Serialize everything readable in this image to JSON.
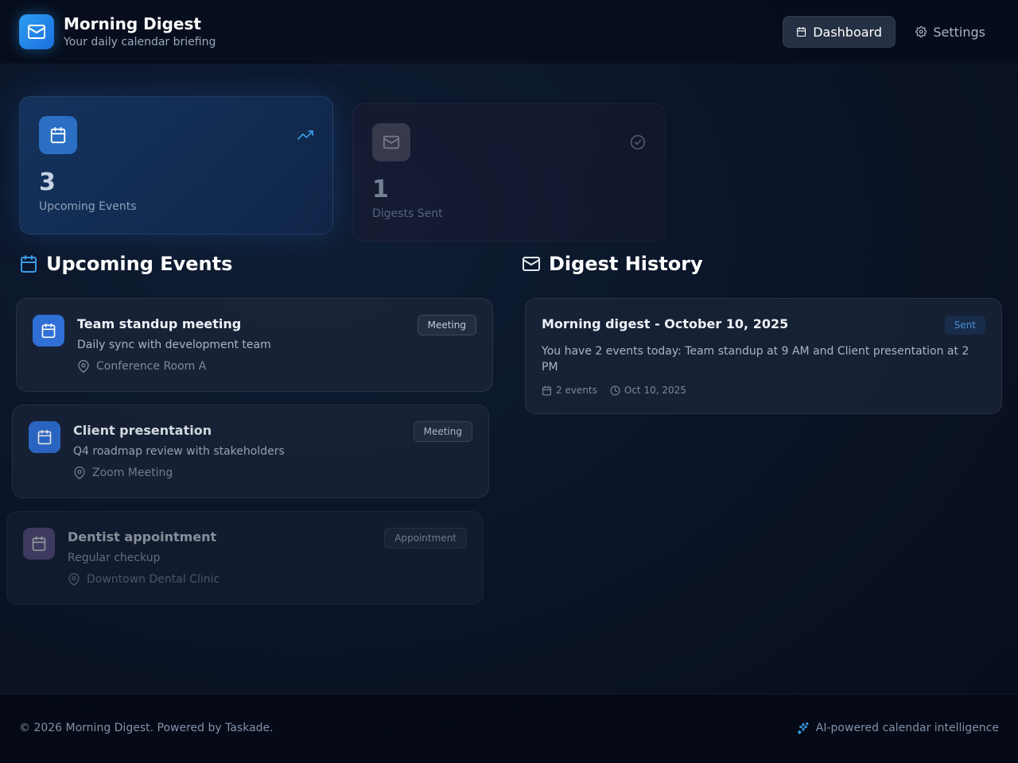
{
  "header": {
    "title": "Morning Digest",
    "subtitle": "Your daily calendar briefing",
    "logo_icon": "mail-icon",
    "nav": [
      {
        "label": "Dashboard",
        "icon": "calendar-icon",
        "active": true
      },
      {
        "label": "Settings",
        "icon": "gear-icon",
        "active": false
      }
    ]
  },
  "stats": [
    {
      "value": "3",
      "label": "Upcoming Events",
      "icon": "calendar-icon",
      "indicator": "trending-up-icon",
      "color": "#2a6fc4"
    },
    {
      "value": "1",
      "label": "Digests Sent",
      "icon": "mail-icon",
      "indicator": "check-circle-icon",
      "color": "#5a5466"
    }
  ],
  "sections": {
    "events_title": "Upcoming Events",
    "digest_title": "Digest History"
  },
  "events": [
    {
      "title": "Team standup meeting",
      "description": "Daily sync with development team",
      "location": "Conference Room A",
      "tag": "Meeting"
    },
    {
      "title": "Client presentation",
      "description": "Q4 roadmap review with stakeholders",
      "location": "Zoom Meeting",
      "tag": "Meeting"
    },
    {
      "title": "Dentist appointment",
      "description": "Regular checkup",
      "location": "Downtown Dental Clinic",
      "tag": "Appointment"
    }
  ],
  "digests": [
    {
      "title": "Morning digest - October 10, 2025",
      "status": "Sent",
      "body": "You have 2 events today: Team standup at 9 AM and Client presentation at 2 PM",
      "events_count": "2 events",
      "date": "Oct 10, 2025"
    }
  ],
  "footer": {
    "copyright": "© 2026 Morning Digest. Powered by Taskade.",
    "tagline": "AI-powered calendar intelligence"
  },
  "colors": {
    "accent": "#2b9df0",
    "event_icon": "#2f6fd6",
    "appointment_icon": "#6a5a8e"
  }
}
